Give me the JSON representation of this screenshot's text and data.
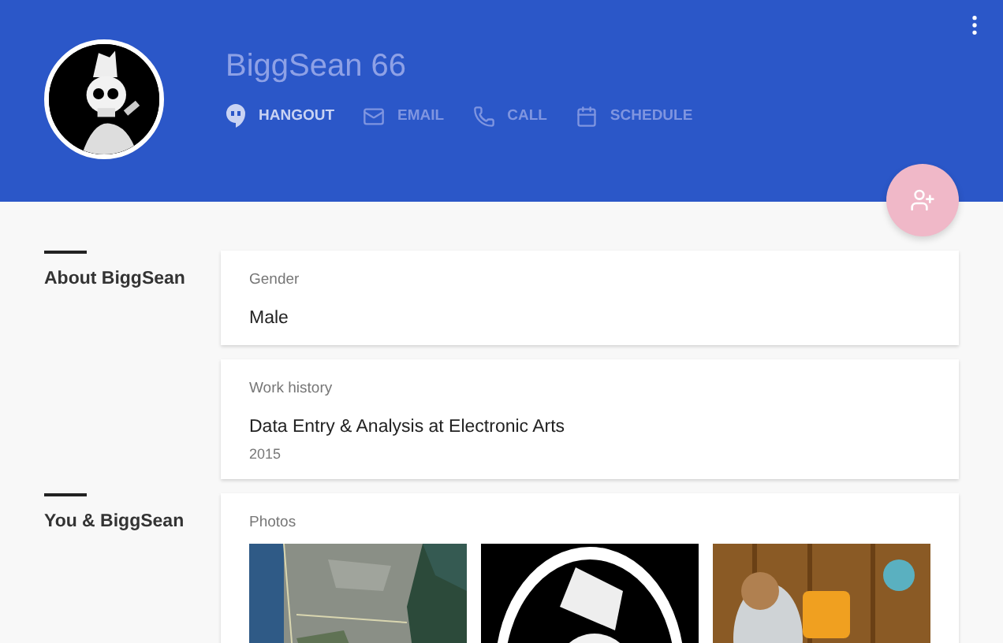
{
  "header": {
    "name": "BiggSean 66",
    "actions": [
      {
        "kind": "hangout",
        "label": "HANGOUT",
        "selected": true
      },
      {
        "kind": "email",
        "label": "EMAIL",
        "selected": false
      },
      {
        "kind": "call",
        "label": "CALL",
        "selected": false
      },
      {
        "kind": "schedule",
        "label": "SCHEDULE",
        "selected": false
      }
    ]
  },
  "sections": [
    {
      "title": "About BiggSean",
      "cards": [
        {
          "kind": "field",
          "label": "Gender",
          "value": "Male"
        },
        {
          "kind": "field",
          "label": "Work history",
          "value": "Data Entry & Analysis at Electronic Arts",
          "detail": "2015"
        }
      ]
    },
    {
      "title": "You & BiggSean",
      "cards": [
        {
          "kind": "photos",
          "label": "Photos",
          "photos": [
            {
              "kind": "map"
            },
            {
              "kind": "emblem"
            },
            {
              "kind": "game"
            }
          ]
        }
      ]
    }
  ]
}
